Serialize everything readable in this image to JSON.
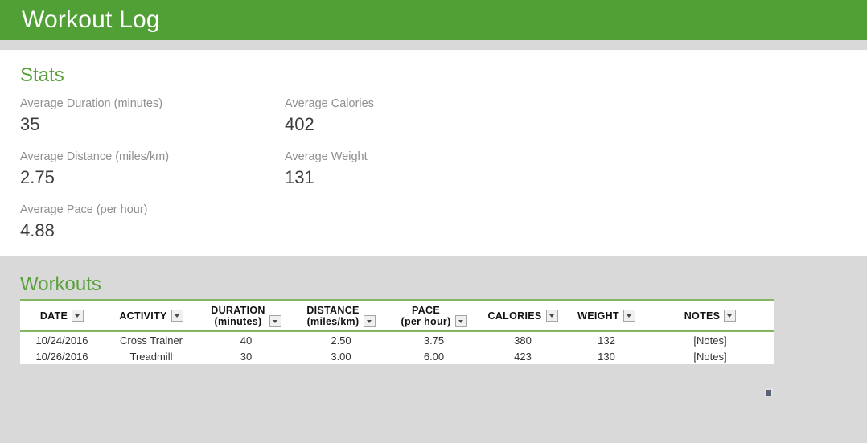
{
  "app": {
    "title": "Workout Log",
    "header_color": "#51a035",
    "accent_color": "#5aa03c",
    "page_background": "#d9d9d9",
    "panel_background": "#ffffff"
  },
  "stats": {
    "section_title": "Stats",
    "items": [
      {
        "label": "Average Duration (minutes)",
        "value": "35"
      },
      {
        "label": "Average Calories",
        "value": "402"
      },
      {
        "label": "Average Distance (miles/km)",
        "value": "2.75"
      },
      {
        "label": "Average Weight",
        "value": "131"
      },
      {
        "label": "Average Pace (per hour)",
        "value": "4.88"
      }
    ]
  },
  "workouts": {
    "section_title": "Workouts",
    "filter_icon": "chevron-down-icon",
    "columns": [
      {
        "main": "DATE",
        "sub": "",
        "filter": true
      },
      {
        "main": "ACTIVITY",
        "sub": "",
        "filter": true
      },
      {
        "main": "DURATION",
        "sub": "(minutes)",
        "filter": true
      },
      {
        "main": "DISTANCE",
        "sub": "(miles/km)",
        "filter": true
      },
      {
        "main": "PACE",
        "sub": "(per hour)",
        "filter": true
      },
      {
        "main": "CALORIES",
        "sub": "",
        "filter": true
      },
      {
        "main": "WEIGHT",
        "sub": "",
        "filter": true
      },
      {
        "main": "NOTES",
        "sub": "",
        "filter": true
      }
    ],
    "rows": [
      {
        "date": "10/24/2016",
        "activity": "Cross Trainer",
        "duration": "40",
        "distance": "2.50",
        "pace": "3.75",
        "calories": "380",
        "weight": "132",
        "notes": "[Notes]"
      },
      {
        "date": "10/26/2016",
        "activity": "Treadmill",
        "duration": "30",
        "distance": "3.00",
        "pace": "6.00",
        "calories": "423",
        "weight": "130",
        "notes": "[Notes]"
      }
    ]
  }
}
